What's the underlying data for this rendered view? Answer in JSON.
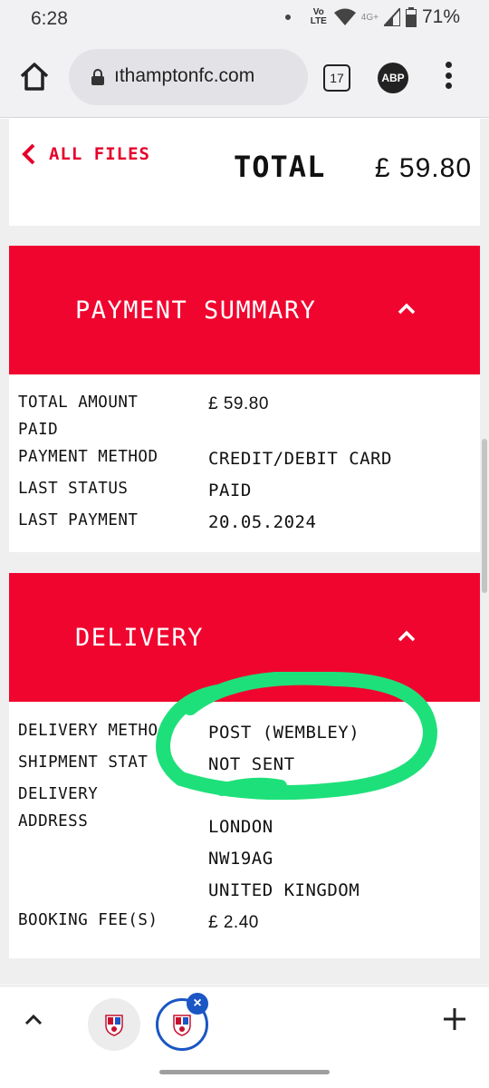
{
  "status_bar": {
    "time": "6:28",
    "network": "Vo LTE",
    "signal_type": "4G+",
    "battery": "71%"
  },
  "browser": {
    "url": "ıthamptonfc.com",
    "tab_count": "17",
    "adblock": "ABP"
  },
  "header": {
    "back_label": "ALL FILES",
    "total_label": "TOTAL",
    "total_value": "£ 59.80"
  },
  "payment_summary": {
    "title": "PAYMENT SUMMARY",
    "rows": [
      {
        "label": "TOTAL AMOUNT",
        "label2": "PAID",
        "value": "£ 59.80"
      },
      {
        "label": "PAYMENT METHOD",
        "value": "CREDIT/DEBIT CARD"
      },
      {
        "label": "LAST STATUS",
        "value": "PAID"
      },
      {
        "label": "LAST PAYMENT",
        "value": "20.05.2024"
      }
    ]
  },
  "delivery": {
    "title": "DELIVERY",
    "rows": [
      {
        "label": "DELIVERY METHO",
        "value": "POST (WEMBLEY)"
      },
      {
        "label": "SHIPMENT STAT",
        "value": "NOT SENT"
      },
      {
        "label": "DELIVERY",
        "label2": "ADDRESS",
        "value": "LONDON",
        "value2": "NW19AG",
        "value3": "UNITED KINGDOM"
      },
      {
        "label": "BOOKING FEE(S)",
        "value": "£ 2.40"
      }
    ]
  },
  "colors": {
    "brand_red": "#f0052f",
    "link_red": "#e5002b",
    "annotation_green": "#1ee07a",
    "active_tab_blue": "#1a56c4"
  },
  "icons": [
    "home-icon",
    "lock-icon",
    "tab-switcher-icon",
    "adblock-icon",
    "more-vert-icon",
    "chevron-left-icon",
    "chevron-up-icon",
    "close-icon",
    "plus-icon",
    "saints-crest-icon"
  ]
}
